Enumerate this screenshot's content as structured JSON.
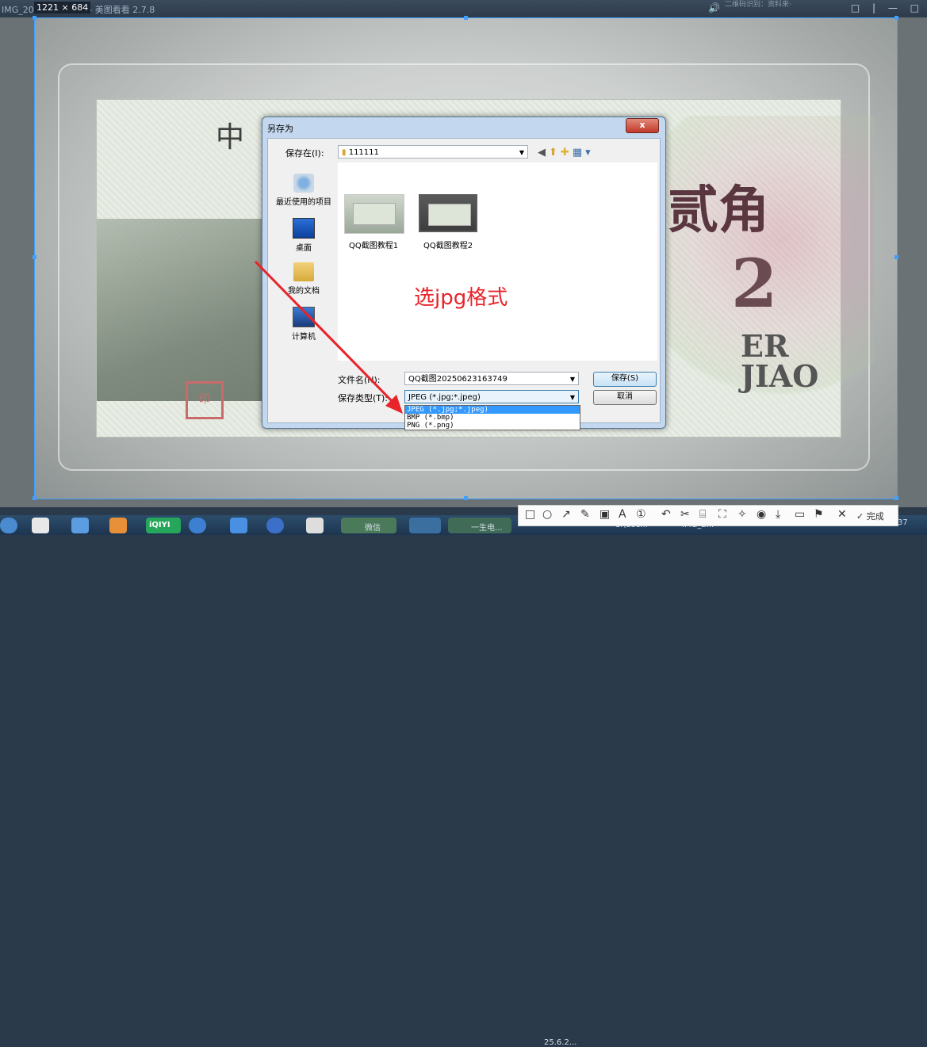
{
  "window": {
    "title": "IMG_202",
    "title_suffix": "109 - 美图看看 2.7.8",
    "dim_badge": "1221 × 684",
    "info_text": "二维码识别：资料来·",
    "window_buttons": "□ | — □"
  },
  "photo": {
    "note_char_zhong": "中",
    "note_big_chars": "贰角",
    "note_number": "2",
    "note_er": "ER",
    "note_jiao": "JIAO",
    "seal_text": "印"
  },
  "dialog": {
    "title": "另存为",
    "close_label": "x",
    "save_in_label": "保存在(I):",
    "save_in_value": "111111",
    "places": [
      {
        "label": "最近使用的项目",
        "icon": "recent-icon"
      },
      {
        "label": "桌面",
        "icon": "desktop-icon"
      },
      {
        "label": "我的文档",
        "icon": "documents-icon"
      },
      {
        "label": "计算机",
        "icon": "computer-icon"
      }
    ],
    "files": [
      {
        "name": "QQ截图教程1"
      },
      {
        "name": "QQ截图教程2"
      }
    ],
    "filename_label": "文件名(N):",
    "filename_value": "QQ截图20250623163749",
    "filetype_label": "保存类型(T):",
    "filetype_value": "JPEG (*.jpg;*.jpeg)",
    "save_button": "保存(S)",
    "cancel_button": "取消",
    "filetype_options": [
      "JPEG (*.jpg;*.jpeg)",
      "BMP (*.bmp)",
      "PNG (*.png)"
    ]
  },
  "annotation": {
    "text": "选jpg格式",
    "color": "#e8232a"
  },
  "screenshot_toolbar": {
    "done_label": "✓ 完成"
  },
  "taskbar": {
    "items": [
      "iQIYI",
      "微信",
      "一生电...",
      "25.6.2...",
      "C:\\Use...",
      "IMG_2..."
    ],
    "clock": "37"
  }
}
